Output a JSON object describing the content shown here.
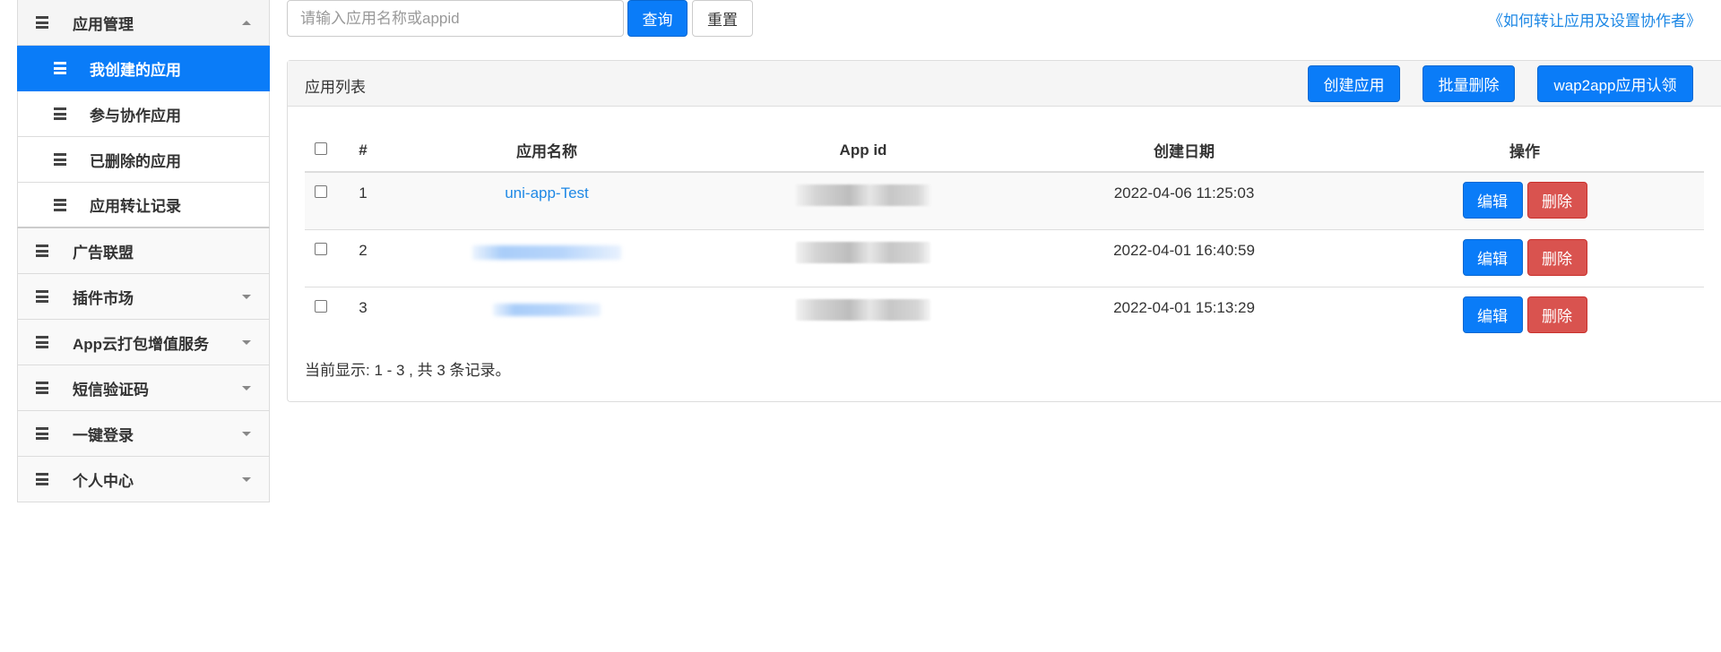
{
  "sidebar": {
    "app_management": "应用管理",
    "sub_items": [
      "我创建的应用",
      "参与协作应用",
      "已删除的应用",
      "应用转让记录"
    ],
    "other_items": [
      {
        "label": "广告联盟",
        "caret": false
      },
      {
        "label": "插件市场",
        "caret": true
      },
      {
        "label": "App云打包增值服务",
        "caret": true
      },
      {
        "label": "短信验证码",
        "caret": true
      },
      {
        "label": "一键登录",
        "caret": true
      },
      {
        "label": "个人中心",
        "caret": true
      }
    ]
  },
  "search": {
    "placeholder": "请输入应用名称或appid",
    "query_label": "查询",
    "reset_label": "重置"
  },
  "help_link": "《如何转让应用及设置协作者》",
  "panel": {
    "title": "应用列表",
    "create_label": "创建应用",
    "batch_delete_label": "批量删除",
    "wap2app_label": "wap2app应用认领"
  },
  "table": {
    "headers": [
      "#",
      "应用名称",
      "App id",
      "创建日期",
      "操作"
    ],
    "rows": [
      {
        "index": "1",
        "name": "uni-app-Test",
        "date": "2022-04-06 11:25:03"
      },
      {
        "index": "2",
        "name": "",
        "date": "2022-04-01 16:40:59"
      },
      {
        "index": "3",
        "name": "",
        "date": "2022-04-01 15:13:29"
      }
    ],
    "edit_label": "编辑",
    "delete_label": "删除"
  },
  "footer": "当前显示: 1 - 3 , 共 3 条记录。",
  "colors": {
    "primary": "#0a7cf8",
    "danger": "#d9534f",
    "link": "#1e88e5"
  }
}
